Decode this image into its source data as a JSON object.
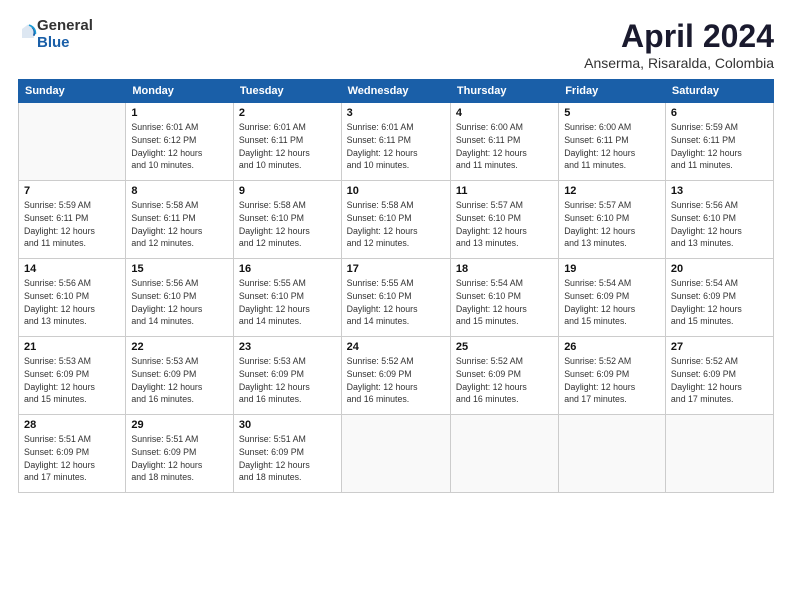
{
  "logo": {
    "line1": "General",
    "line2": "Blue"
  },
  "title": "April 2024",
  "subtitle": "Anserma, Risaralda, Colombia",
  "days_header": [
    "Sunday",
    "Monday",
    "Tuesday",
    "Wednesday",
    "Thursday",
    "Friday",
    "Saturday"
  ],
  "weeks": [
    [
      {
        "num": "",
        "info": ""
      },
      {
        "num": "1",
        "info": "Sunrise: 6:01 AM\nSunset: 6:12 PM\nDaylight: 12 hours\nand 10 minutes."
      },
      {
        "num": "2",
        "info": "Sunrise: 6:01 AM\nSunset: 6:11 PM\nDaylight: 12 hours\nand 10 minutes."
      },
      {
        "num": "3",
        "info": "Sunrise: 6:01 AM\nSunset: 6:11 PM\nDaylight: 12 hours\nand 10 minutes."
      },
      {
        "num": "4",
        "info": "Sunrise: 6:00 AM\nSunset: 6:11 PM\nDaylight: 12 hours\nand 11 minutes."
      },
      {
        "num": "5",
        "info": "Sunrise: 6:00 AM\nSunset: 6:11 PM\nDaylight: 12 hours\nand 11 minutes."
      },
      {
        "num": "6",
        "info": "Sunrise: 5:59 AM\nSunset: 6:11 PM\nDaylight: 12 hours\nand 11 minutes."
      }
    ],
    [
      {
        "num": "7",
        "info": "Sunrise: 5:59 AM\nSunset: 6:11 PM\nDaylight: 12 hours\nand 11 minutes."
      },
      {
        "num": "8",
        "info": "Sunrise: 5:58 AM\nSunset: 6:11 PM\nDaylight: 12 hours\nand 12 minutes."
      },
      {
        "num": "9",
        "info": "Sunrise: 5:58 AM\nSunset: 6:10 PM\nDaylight: 12 hours\nand 12 minutes."
      },
      {
        "num": "10",
        "info": "Sunrise: 5:58 AM\nSunset: 6:10 PM\nDaylight: 12 hours\nand 12 minutes."
      },
      {
        "num": "11",
        "info": "Sunrise: 5:57 AM\nSunset: 6:10 PM\nDaylight: 12 hours\nand 13 minutes."
      },
      {
        "num": "12",
        "info": "Sunrise: 5:57 AM\nSunset: 6:10 PM\nDaylight: 12 hours\nand 13 minutes."
      },
      {
        "num": "13",
        "info": "Sunrise: 5:56 AM\nSunset: 6:10 PM\nDaylight: 12 hours\nand 13 minutes."
      }
    ],
    [
      {
        "num": "14",
        "info": "Sunrise: 5:56 AM\nSunset: 6:10 PM\nDaylight: 12 hours\nand 13 minutes."
      },
      {
        "num": "15",
        "info": "Sunrise: 5:56 AM\nSunset: 6:10 PM\nDaylight: 12 hours\nand 14 minutes."
      },
      {
        "num": "16",
        "info": "Sunrise: 5:55 AM\nSunset: 6:10 PM\nDaylight: 12 hours\nand 14 minutes."
      },
      {
        "num": "17",
        "info": "Sunrise: 5:55 AM\nSunset: 6:10 PM\nDaylight: 12 hours\nand 14 minutes."
      },
      {
        "num": "18",
        "info": "Sunrise: 5:54 AM\nSunset: 6:10 PM\nDaylight: 12 hours\nand 15 minutes."
      },
      {
        "num": "19",
        "info": "Sunrise: 5:54 AM\nSunset: 6:09 PM\nDaylight: 12 hours\nand 15 minutes."
      },
      {
        "num": "20",
        "info": "Sunrise: 5:54 AM\nSunset: 6:09 PM\nDaylight: 12 hours\nand 15 minutes."
      }
    ],
    [
      {
        "num": "21",
        "info": "Sunrise: 5:53 AM\nSunset: 6:09 PM\nDaylight: 12 hours\nand 15 minutes."
      },
      {
        "num": "22",
        "info": "Sunrise: 5:53 AM\nSunset: 6:09 PM\nDaylight: 12 hours\nand 16 minutes."
      },
      {
        "num": "23",
        "info": "Sunrise: 5:53 AM\nSunset: 6:09 PM\nDaylight: 12 hours\nand 16 minutes."
      },
      {
        "num": "24",
        "info": "Sunrise: 5:52 AM\nSunset: 6:09 PM\nDaylight: 12 hours\nand 16 minutes."
      },
      {
        "num": "25",
        "info": "Sunrise: 5:52 AM\nSunset: 6:09 PM\nDaylight: 12 hours\nand 16 minutes."
      },
      {
        "num": "26",
        "info": "Sunrise: 5:52 AM\nSunset: 6:09 PM\nDaylight: 12 hours\nand 17 minutes."
      },
      {
        "num": "27",
        "info": "Sunrise: 5:52 AM\nSunset: 6:09 PM\nDaylight: 12 hours\nand 17 minutes."
      }
    ],
    [
      {
        "num": "28",
        "info": "Sunrise: 5:51 AM\nSunset: 6:09 PM\nDaylight: 12 hours\nand 17 minutes."
      },
      {
        "num": "29",
        "info": "Sunrise: 5:51 AM\nSunset: 6:09 PM\nDaylight: 12 hours\nand 18 minutes."
      },
      {
        "num": "30",
        "info": "Sunrise: 5:51 AM\nSunset: 6:09 PM\nDaylight: 12 hours\nand 18 minutes."
      },
      {
        "num": "",
        "info": ""
      },
      {
        "num": "",
        "info": ""
      },
      {
        "num": "",
        "info": ""
      },
      {
        "num": "",
        "info": ""
      }
    ]
  ]
}
